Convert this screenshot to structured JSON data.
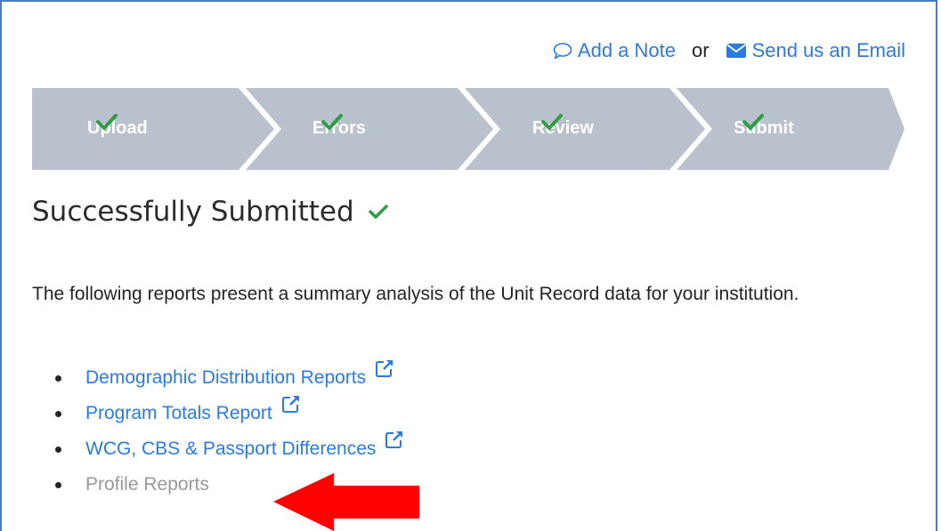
{
  "header_links": {
    "add_note": "Add a Note",
    "separator": "or",
    "send_email": "Send us an Email",
    "icons": [
      "comment-icon",
      "envelope-icon"
    ]
  },
  "steps": [
    {
      "label": "Upload",
      "status": "complete"
    },
    {
      "label": "Errors",
      "status": "complete"
    },
    {
      "label": "Review",
      "status": "complete"
    },
    {
      "label": "Submit",
      "status": "complete"
    }
  ],
  "title": "Successfully Submitted",
  "description": "The following reports present a summary analysis of the Unit Record data for your institution.",
  "reports": [
    {
      "label": "Demographic Distribution Reports",
      "enabled": true
    },
    {
      "label": "Program Totals Report",
      "enabled": true
    },
    {
      "label": "WCG, CBS & Passport Differences",
      "enabled": true
    },
    {
      "label": "Profile Reports",
      "enabled": false
    }
  ],
  "colors": {
    "link": "#2a7ae2",
    "step_bg": "#b9c1cc",
    "check": "#2e9e44",
    "annotation_arrow": "#ff0000",
    "disabled_text": "#999999"
  }
}
